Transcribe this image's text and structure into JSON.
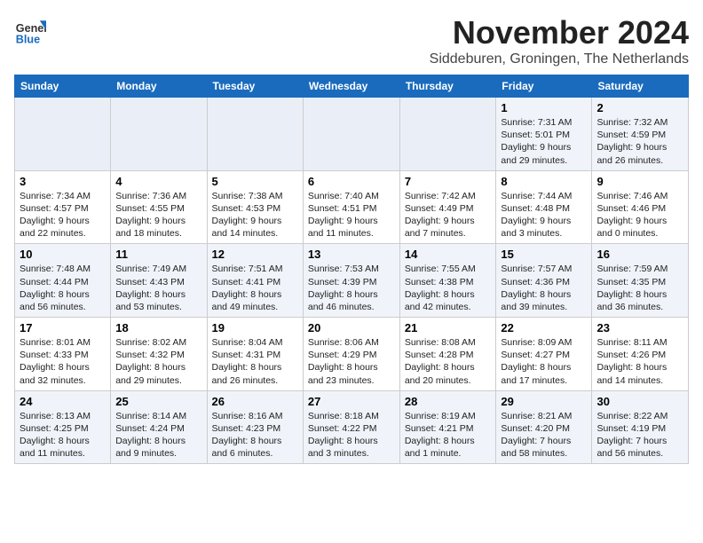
{
  "header": {
    "logo_line1": "General",
    "logo_line2": "Blue",
    "month": "November 2024",
    "location": "Siddeburen, Groningen, The Netherlands"
  },
  "weekdays": [
    "Sunday",
    "Monday",
    "Tuesday",
    "Wednesday",
    "Thursday",
    "Friday",
    "Saturday"
  ],
  "weeks": [
    [
      {
        "day": "",
        "info": ""
      },
      {
        "day": "",
        "info": ""
      },
      {
        "day": "",
        "info": ""
      },
      {
        "day": "",
        "info": ""
      },
      {
        "day": "",
        "info": ""
      },
      {
        "day": "1",
        "info": "Sunrise: 7:31 AM\nSunset: 5:01 PM\nDaylight: 9 hours and 29 minutes."
      },
      {
        "day": "2",
        "info": "Sunrise: 7:32 AM\nSunset: 4:59 PM\nDaylight: 9 hours and 26 minutes."
      }
    ],
    [
      {
        "day": "3",
        "info": "Sunrise: 7:34 AM\nSunset: 4:57 PM\nDaylight: 9 hours and 22 minutes."
      },
      {
        "day": "4",
        "info": "Sunrise: 7:36 AM\nSunset: 4:55 PM\nDaylight: 9 hours and 18 minutes."
      },
      {
        "day": "5",
        "info": "Sunrise: 7:38 AM\nSunset: 4:53 PM\nDaylight: 9 hours and 14 minutes."
      },
      {
        "day": "6",
        "info": "Sunrise: 7:40 AM\nSunset: 4:51 PM\nDaylight: 9 hours and 11 minutes."
      },
      {
        "day": "7",
        "info": "Sunrise: 7:42 AM\nSunset: 4:49 PM\nDaylight: 9 hours and 7 minutes."
      },
      {
        "day": "8",
        "info": "Sunrise: 7:44 AM\nSunset: 4:48 PM\nDaylight: 9 hours and 3 minutes."
      },
      {
        "day": "9",
        "info": "Sunrise: 7:46 AM\nSunset: 4:46 PM\nDaylight: 9 hours and 0 minutes."
      }
    ],
    [
      {
        "day": "10",
        "info": "Sunrise: 7:48 AM\nSunset: 4:44 PM\nDaylight: 8 hours and 56 minutes."
      },
      {
        "day": "11",
        "info": "Sunrise: 7:49 AM\nSunset: 4:43 PM\nDaylight: 8 hours and 53 minutes."
      },
      {
        "day": "12",
        "info": "Sunrise: 7:51 AM\nSunset: 4:41 PM\nDaylight: 8 hours and 49 minutes."
      },
      {
        "day": "13",
        "info": "Sunrise: 7:53 AM\nSunset: 4:39 PM\nDaylight: 8 hours and 46 minutes."
      },
      {
        "day": "14",
        "info": "Sunrise: 7:55 AM\nSunset: 4:38 PM\nDaylight: 8 hours and 42 minutes."
      },
      {
        "day": "15",
        "info": "Sunrise: 7:57 AM\nSunset: 4:36 PM\nDaylight: 8 hours and 39 minutes."
      },
      {
        "day": "16",
        "info": "Sunrise: 7:59 AM\nSunset: 4:35 PM\nDaylight: 8 hours and 36 minutes."
      }
    ],
    [
      {
        "day": "17",
        "info": "Sunrise: 8:01 AM\nSunset: 4:33 PM\nDaylight: 8 hours and 32 minutes."
      },
      {
        "day": "18",
        "info": "Sunrise: 8:02 AM\nSunset: 4:32 PM\nDaylight: 8 hours and 29 minutes."
      },
      {
        "day": "19",
        "info": "Sunrise: 8:04 AM\nSunset: 4:31 PM\nDaylight: 8 hours and 26 minutes."
      },
      {
        "day": "20",
        "info": "Sunrise: 8:06 AM\nSunset: 4:29 PM\nDaylight: 8 hours and 23 minutes."
      },
      {
        "day": "21",
        "info": "Sunrise: 8:08 AM\nSunset: 4:28 PM\nDaylight: 8 hours and 20 minutes."
      },
      {
        "day": "22",
        "info": "Sunrise: 8:09 AM\nSunset: 4:27 PM\nDaylight: 8 hours and 17 minutes."
      },
      {
        "day": "23",
        "info": "Sunrise: 8:11 AM\nSunset: 4:26 PM\nDaylight: 8 hours and 14 minutes."
      }
    ],
    [
      {
        "day": "24",
        "info": "Sunrise: 8:13 AM\nSunset: 4:25 PM\nDaylight: 8 hours and 11 minutes."
      },
      {
        "day": "25",
        "info": "Sunrise: 8:14 AM\nSunset: 4:24 PM\nDaylight: 8 hours and 9 minutes."
      },
      {
        "day": "26",
        "info": "Sunrise: 8:16 AM\nSunset: 4:23 PM\nDaylight: 8 hours and 6 minutes."
      },
      {
        "day": "27",
        "info": "Sunrise: 8:18 AM\nSunset: 4:22 PM\nDaylight: 8 hours and 3 minutes."
      },
      {
        "day": "28",
        "info": "Sunrise: 8:19 AM\nSunset: 4:21 PM\nDaylight: 8 hours and 1 minute."
      },
      {
        "day": "29",
        "info": "Sunrise: 8:21 AM\nSunset: 4:20 PM\nDaylight: 7 hours and 58 minutes."
      },
      {
        "day": "30",
        "info": "Sunrise: 8:22 AM\nSunset: 4:19 PM\nDaylight: 7 hours and 56 minutes."
      }
    ]
  ]
}
